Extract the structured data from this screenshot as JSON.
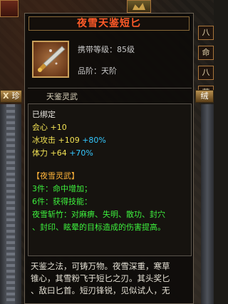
{
  "tooltip": {
    "title": "夜雪天鉴短匕",
    "level_req": "携带等级：85级",
    "grade": "品阶：天阶",
    "section_title": "天鉴灵武",
    "bound": "已绑定",
    "stats": [
      {
        "name": "会心",
        "value": "+10",
        "bonus": ""
      },
      {
        "name": "冰攻击",
        "value": "+109",
        "bonus": "+80%"
      },
      {
        "name": "体力",
        "value": "+64",
        "bonus": "+70%"
      }
    ],
    "set": {
      "name": "【夜雪灵武】",
      "tier3": "3件：命中增加；",
      "tier6": "6件：获得技能：",
      "skill_line1": "夜雪斩竹：对麻痹、失明、散功、封穴",
      "skill_line2": "、封印、眩晕的目标造成的伤害提高。"
    },
    "description_line1": "天鉴之法，可铸万物。夜雪深重，寒草",
    "description_line2": "锥心，其雪粉飞于短匕之刃。其头奖匕",
    "description_line3": "、敌曰匕首。短刃锋锐，见似试人，无"
  },
  "sidebar": {
    "items": [
      "八",
      "命",
      "八",
      "获"
    ]
  },
  "tabs": {
    "left_close": "X",
    "left_label": "珍",
    "right_label": "绒"
  },
  "colors": {
    "title": "#ff5a28",
    "stat_bonus": "#34c8ff",
    "set_effect": "#3df03d",
    "base_stat": "#f2e254"
  }
}
